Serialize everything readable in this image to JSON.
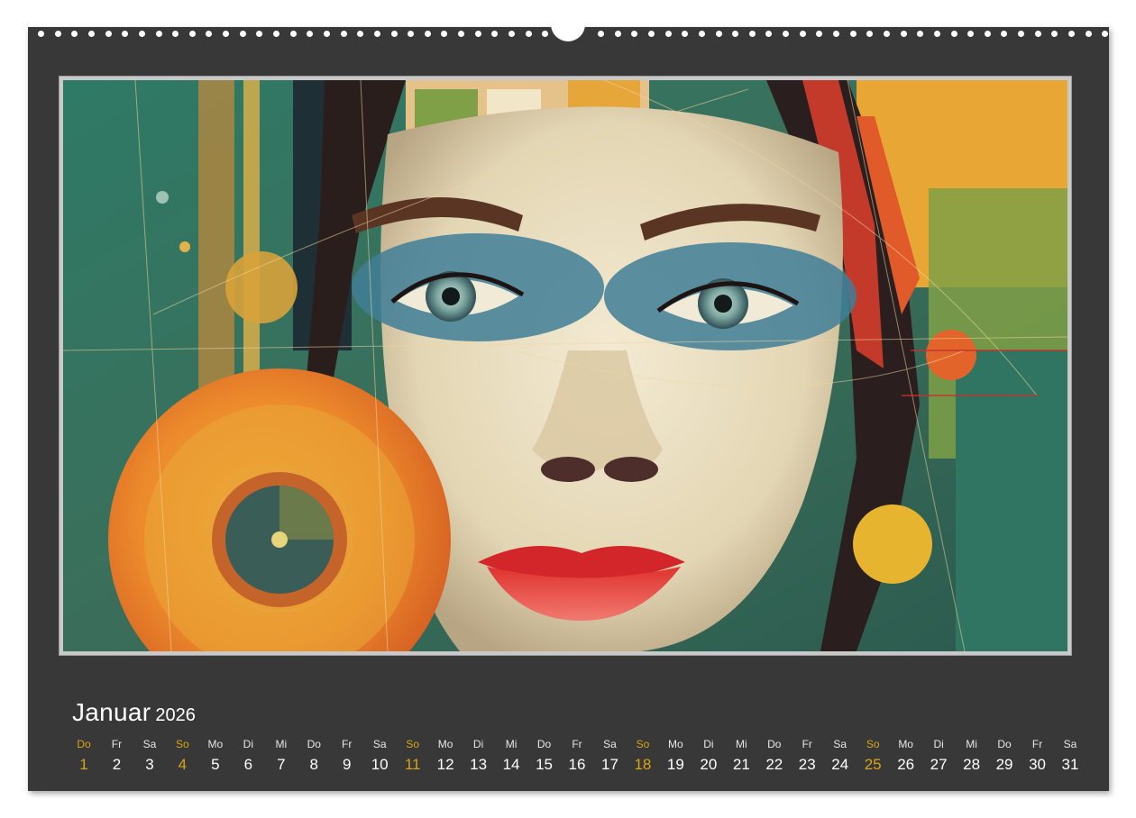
{
  "calendar": {
    "month": "Januar",
    "year": "2026",
    "accent_color": "#d9a514",
    "background_color": "#383838",
    "days": [
      {
        "weekday": "Do",
        "day": "1",
        "highlight": true
      },
      {
        "weekday": "Fr",
        "day": "2",
        "highlight": false
      },
      {
        "weekday": "Sa",
        "day": "3",
        "highlight": false
      },
      {
        "weekday": "So",
        "day": "4",
        "highlight": true
      },
      {
        "weekday": "Mo",
        "day": "5",
        "highlight": false
      },
      {
        "weekday": "Di",
        "day": "6",
        "highlight": false
      },
      {
        "weekday": "Mi",
        "day": "7",
        "highlight": false
      },
      {
        "weekday": "Do",
        "day": "8",
        "highlight": false
      },
      {
        "weekday": "Fr",
        "day": "9",
        "highlight": false
      },
      {
        "weekday": "Sa",
        "day": "10",
        "highlight": false
      },
      {
        "weekday": "So",
        "day": "11",
        "highlight": true
      },
      {
        "weekday": "Mo",
        "day": "12",
        "highlight": false
      },
      {
        "weekday": "Di",
        "day": "13",
        "highlight": false
      },
      {
        "weekday": "Mi",
        "day": "14",
        "highlight": false
      },
      {
        "weekday": "Do",
        "day": "15",
        "highlight": false
      },
      {
        "weekday": "Fr",
        "day": "16",
        "highlight": false
      },
      {
        "weekday": "Sa",
        "day": "17",
        "highlight": false
      },
      {
        "weekday": "So",
        "day": "18",
        "highlight": true
      },
      {
        "weekday": "Mo",
        "day": "19",
        "highlight": false
      },
      {
        "weekday": "Di",
        "day": "20",
        "highlight": false
      },
      {
        "weekday": "Mi",
        "day": "21",
        "highlight": false
      },
      {
        "weekday": "Do",
        "day": "22",
        "highlight": false
      },
      {
        "weekday": "Fr",
        "day": "23",
        "highlight": false
      },
      {
        "weekday": "Sa",
        "day": "24",
        "highlight": false
      },
      {
        "weekday": "So",
        "day": "25",
        "highlight": true
      },
      {
        "weekday": "Mo",
        "day": "26",
        "highlight": false
      },
      {
        "weekday": "Di",
        "day": "27",
        "highlight": false
      },
      {
        "weekday": "Mi",
        "day": "28",
        "highlight": false
      },
      {
        "weekday": "Do",
        "day": "29",
        "highlight": false
      },
      {
        "weekday": "Fr",
        "day": "30",
        "highlight": false
      },
      {
        "weekday": "Sa",
        "day": "31",
        "highlight": false
      }
    ]
  },
  "artwork": {
    "subject": "abstract collage portrait of a woman's face",
    "palette": [
      "#2f6f5c",
      "#e9a52a",
      "#e2642a",
      "#c8322c",
      "#f0e6cc",
      "#6aa0b0",
      "#1e2a33"
    ]
  }
}
